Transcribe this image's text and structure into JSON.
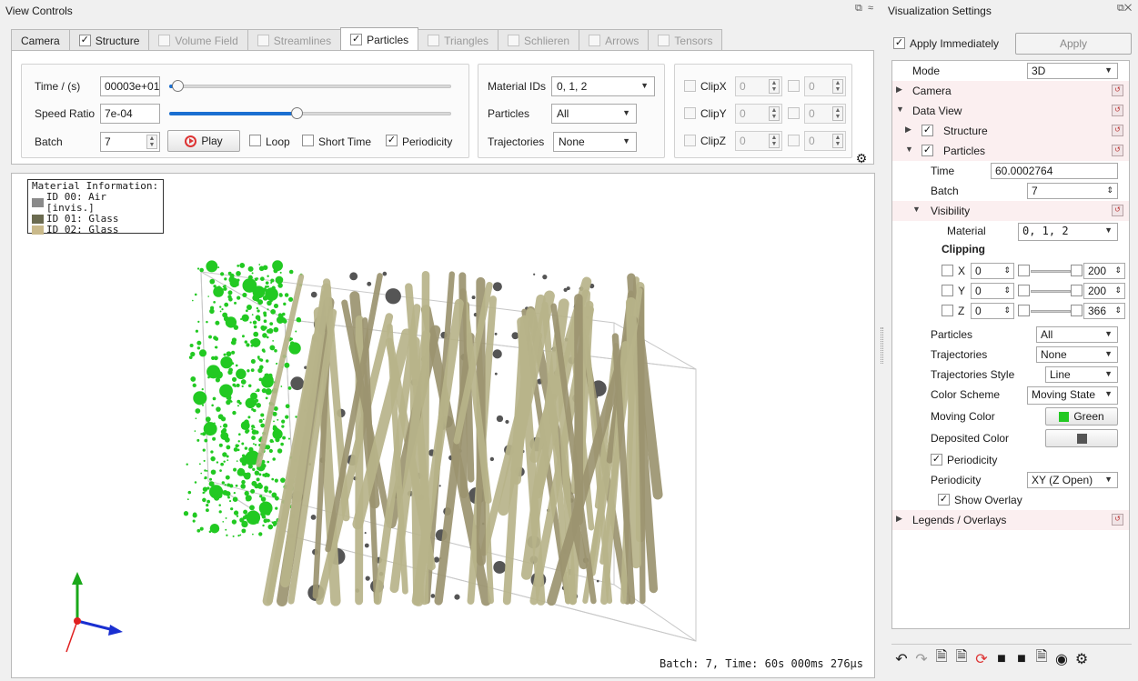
{
  "left_dock": {
    "title": "View Controls",
    "tabs": [
      {
        "label": "Camera",
        "checkbox": false,
        "checked": false,
        "disabled": false,
        "active": false
      },
      {
        "label": "Structure",
        "checkbox": true,
        "checked": true,
        "disabled": false,
        "active": false
      },
      {
        "label": "Volume Field",
        "checkbox": true,
        "checked": false,
        "disabled": true,
        "active": false
      },
      {
        "label": "Streamlines",
        "checkbox": true,
        "checked": false,
        "disabled": true,
        "active": false
      },
      {
        "label": "Particles",
        "checkbox": true,
        "checked": true,
        "disabled": false,
        "active": true
      },
      {
        "label": "Triangles",
        "checkbox": true,
        "checked": false,
        "disabled": true,
        "active": false
      },
      {
        "label": "Schlieren",
        "checkbox": true,
        "checked": false,
        "disabled": true,
        "active": false
      },
      {
        "label": "Arrows",
        "checkbox": true,
        "checked": false,
        "disabled": true,
        "active": false
      },
      {
        "label": "Tensors",
        "checkbox": true,
        "checked": false,
        "disabled": true,
        "active": false
      }
    ],
    "controls": {
      "time_label": "Time / (s)",
      "time_value": "00003e+01",
      "time_slider": 0.03,
      "speed_label": "Speed Ratio",
      "speed_value": "7e-04",
      "speed_slider": 0.45,
      "batch_label": "Batch",
      "batch_value": "7",
      "play_label": "Play",
      "loop_label": "Loop",
      "short_time_label": "Short Time",
      "periodicity_label": "Periodicity",
      "material_ids_label": "Material IDs",
      "material_ids_value": "0, 1, 2",
      "particles_label": "Particles",
      "particles_value": "All",
      "trajectories_label": "Trajectories",
      "trajectories_value": "None",
      "clips": [
        {
          "label": "ClipX",
          "a": "0",
          "b": "0"
        },
        {
          "label": "ClipY",
          "a": "0",
          "b": "0"
        },
        {
          "label": "ClipZ",
          "a": "0",
          "b": "0"
        }
      ]
    },
    "viewport": {
      "legend_title": "Material Information:",
      "legend_items": [
        {
          "text": "ID 00: Air [invis.]",
          "color": "#8a8a8a"
        },
        {
          "text": "ID 01: Glass",
          "color": "#6b6b50"
        },
        {
          "text": "ID 02: Glass",
          "color": "#c9b98a"
        }
      ],
      "status": "Batch:  7, Time:  60s 000ms 276µs",
      "moving_color": "#22c922",
      "fiber_color": "#b8b48a",
      "deposited_color": "#555555"
    }
  },
  "right_dock": {
    "title": "Visualization Settings",
    "apply_immediately_label": "Apply Immediately",
    "apply_label": "Apply",
    "tree": {
      "mode_label": "Mode",
      "mode_value": "3D",
      "camera_label": "Camera",
      "data_view_label": "Data View",
      "structure_label": "Structure",
      "particles_label": "Particles",
      "time_label": "Time",
      "time_value": "60.0002764",
      "batch_label": "Batch",
      "batch_value": "7",
      "visibility_label": "Visibility",
      "material_label": "Material",
      "material_value": "0, 1, 2",
      "clipping_label": "Clipping",
      "clip_rows": [
        {
          "axis": "X",
          "min": "0",
          "max": "200"
        },
        {
          "axis": "Y",
          "min": "0",
          "max": "200"
        },
        {
          "axis": "Z",
          "min": "0",
          "max": "366"
        }
      ],
      "particles_sel_label": "Particles",
      "particles_sel_value": "All",
      "trajectories_label": "Trajectories",
      "trajectories_value": "None",
      "traj_style_label": "Trajectories Style",
      "traj_style_value": "Line",
      "color_scheme_label": "Color Scheme",
      "color_scheme_value": "Moving State",
      "moving_color_label": "Moving Color",
      "moving_color_value": "Green",
      "deposited_color_label": "Deposited Color",
      "periodicity_cb_label": "Periodicity",
      "periodicity_label": "Periodicity",
      "periodicity_value": "XY (Z Open)",
      "show_overlay_label": "Show Overlay",
      "legends_label": "Legends / Overlays"
    }
  }
}
